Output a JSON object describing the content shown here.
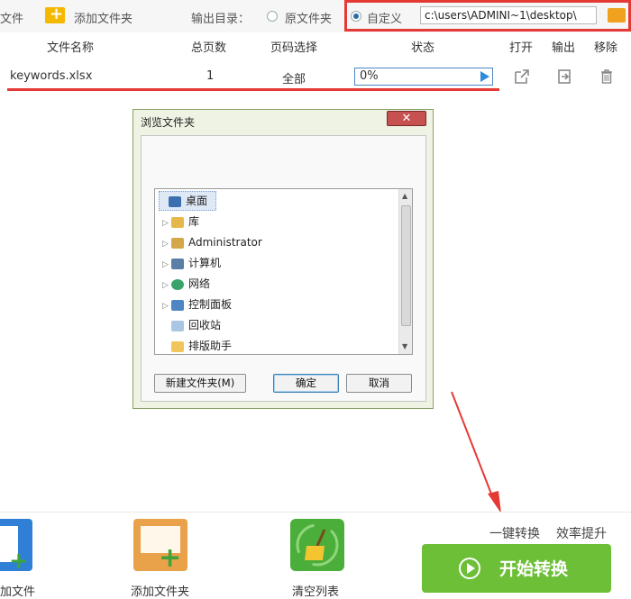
{
  "toolbar": {
    "add_file_label": "文件",
    "add_folder_label": "添加文件夹",
    "output_dir_label": "输出目录：",
    "option_original_label": "原文件夹",
    "option_custom_label": "自定义",
    "output_path": "c:\\users\\ADMINI~1\\desktop\\"
  },
  "table": {
    "headers": [
      "文件名称",
      "总页数",
      "页码选择",
      "状态",
      "打开",
      "输出",
      "移除"
    ],
    "rows": [
      {
        "filename": "keywords.xlsx",
        "pages": "1",
        "page_selection": "全部",
        "status": "0%"
      }
    ]
  },
  "dialog": {
    "title": "浏览文件夹",
    "close_label": "✕",
    "tree": [
      {
        "label": "桌面",
        "icon": "desktop-icon",
        "selected": true,
        "expandable": false
      },
      {
        "label": "库",
        "icon": "library-icon",
        "expandable": true
      },
      {
        "label": "Administrator",
        "icon": "user-folder-icon",
        "expandable": true
      },
      {
        "label": "计算机",
        "icon": "computer-icon",
        "expandable": true
      },
      {
        "label": "网络",
        "icon": "network-icon",
        "expandable": true
      },
      {
        "label": "控制面板",
        "icon": "control-panel-icon",
        "expandable": true
      },
      {
        "label": "回收站",
        "icon": "recycle-bin-icon",
        "expandable": false
      },
      {
        "label": "排版助手",
        "icon": "folder-icon",
        "expandable": false
      }
    ],
    "new_folder_label": "新建文件夹(M)",
    "ok_label": "确定",
    "cancel_label": "取消"
  },
  "bottom": {
    "add_file_label": "加文件",
    "add_folder_label": "添加文件夹",
    "clear_list_label": "清空列表",
    "slogan1": "一键转换",
    "slogan2": "效率提升",
    "start_label": "开始转换"
  },
  "colors": {
    "accent_green": "#6cbf37",
    "highlight_red": "#e53935",
    "progress_blue": "#4a87c6"
  }
}
